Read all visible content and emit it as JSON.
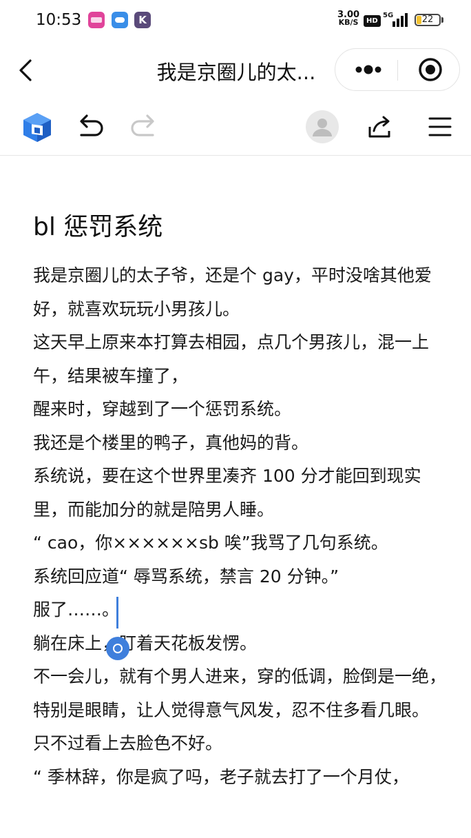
{
  "status_bar": {
    "time": "10:53",
    "net_speed_value": "3.00",
    "net_speed_unit": "KB/S",
    "hd": "HD",
    "network": "5G",
    "battery": "22",
    "battery_level_percent": 22
  },
  "header": {
    "title": "我是京圈儿的太...",
    "back_icon": "chevron-left-icon",
    "more_icon": "more-dots-icon",
    "close_icon": "target-close-icon"
  },
  "toolbar": {
    "logo_icon": "app-logo-icon",
    "undo_icon": "undo-icon",
    "redo_icon": "redo-icon",
    "avatar_icon": "user-avatar-icon",
    "share_icon": "share-icon",
    "menu_icon": "hamburger-menu-icon"
  },
  "article": {
    "title": "bl 惩罚系统",
    "paragraphs": [
      "我是京圈儿的太子爷，还是个 gay，平时没啥其他爱好，就喜欢玩玩小男孩儿。",
      "这天早上原来本打算去相园，点几个男孩儿，混一上午，结果被车撞了，",
      "醒来时，穿越到了一个惩罚系统。",
      "我还是个楼里的鸭子，真他妈的背。",
      "系统说，要在这个世界里凑齐 100 分才能回到现实里，而能加分的就是陪男人睡。",
      "“ cao，你××××××sb 唉”我骂了几句系统。",
      "系统回应道“ 辱骂系统，禁言 20 分钟。”",
      "服了……。",
      "躺在床上，盯着天花板发愣。",
      "不一会儿，就有个男人进来，穿的低调，脸倒是一绝，特别是眼睛，让人觉得意气风发，忍不住多看几眼。",
      "只不过看上去脸色不好。",
      "“ 季林辞，你是疯了吗，老子就去打了一个月仗，"
    ]
  },
  "colors": {
    "accent": "#3f7fdc",
    "logo_primary": "#2f7ee8",
    "logo_dark": "#1f5fc4"
  }
}
